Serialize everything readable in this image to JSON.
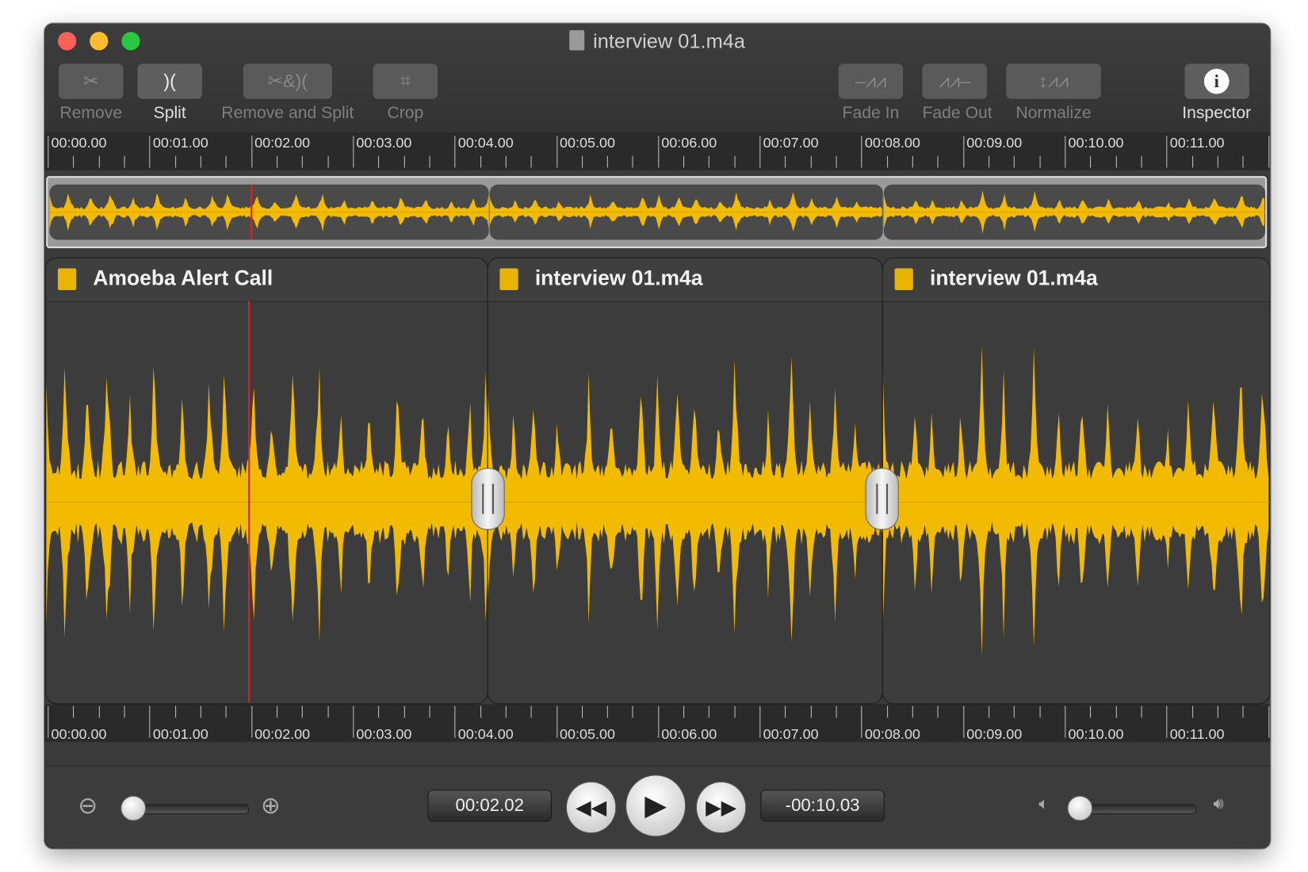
{
  "window": {
    "title": "interview 01.m4a"
  },
  "toolbar": {
    "remove": "Remove",
    "split": "Split",
    "remove_and_split": "Remove and Split",
    "crop": "Crop",
    "fade_in": "Fade In",
    "fade_out": "Fade Out",
    "normalize": "Normalize",
    "inspector": "Inspector"
  },
  "ruler_labels": [
    "00:00.00",
    "00:01.00",
    "00:02.00",
    "00:03.00",
    "00:04.00",
    "00:05.00",
    "00:06.00",
    "00:07.00",
    "00:08.00",
    "00:09.00",
    "00:10.00",
    "00:11.00"
  ],
  "clips": [
    {
      "name": "Amoeba Alert Call"
    },
    {
      "name": "interview 01.m4a"
    },
    {
      "name": "interview 01.m4a"
    }
  ],
  "playback": {
    "current_time": "00:02.02",
    "remaining_time": "-00:10.03",
    "zoom_level": 0,
    "volume": 0
  },
  "colors": {
    "waveform": "#f2bb00",
    "playhead": "#e02020",
    "background": "#3a3a3a"
  }
}
